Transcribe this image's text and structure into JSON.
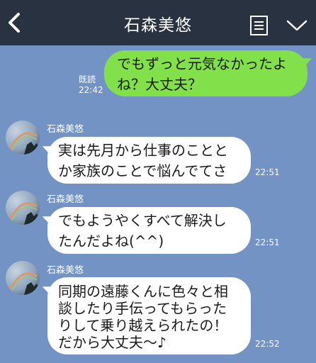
{
  "header": {
    "title": "石森美悠",
    "back_icon": "chevron-left-icon",
    "menu_icon": "note-icon",
    "toggle_icon": "chevron-down-icon"
  },
  "messages": [
    {
      "type": "sent",
      "lines": [
        "でもずっと元気なかったよ",
        "ね？大丈夫？"
      ],
      "read_label": "既読",
      "time": "22:42"
    },
    {
      "type": "received",
      "sender": "石森美悠",
      "lines": [
        "実は先月から仕事のことと",
        "か家族のことで悩んでてさ"
      ],
      "time": "22:51"
    },
    {
      "type": "received",
      "sender": "石森美悠",
      "lines": [
        "でもようやくすべて解決し",
        "たんだよね(^^)"
      ],
      "time": "22:51"
    },
    {
      "type": "received",
      "sender": "石森美悠",
      "lines": [
        "同期の遠藤くんに色々と相",
        "談したり手伝ってもらった",
        "りして乗り越えられたの！",
        "だから大丈夫〜♪"
      ],
      "time": "22:52"
    }
  ],
  "colors": {
    "background": "#7293c3",
    "header": "#283241",
    "sent_bubble": "#82e04b",
    "received_bubble": "#ffffff"
  }
}
